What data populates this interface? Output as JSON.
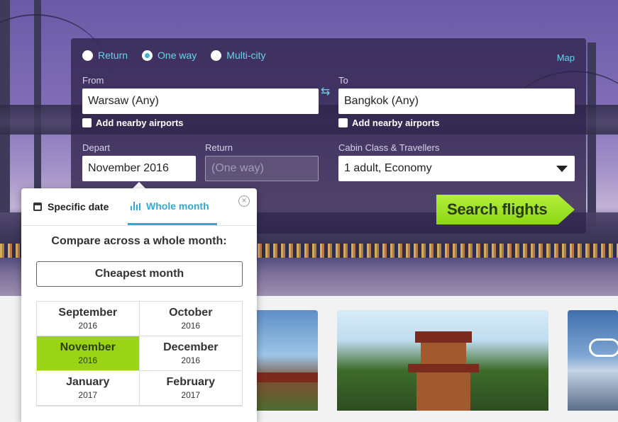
{
  "search": {
    "trip_types": [
      {
        "label": "Return",
        "selected": false
      },
      {
        "label": "One way",
        "selected": true
      },
      {
        "label": "Multi-city",
        "selected": false
      }
    ],
    "map_label": "Map",
    "from_label": "From",
    "from_value": "Warsaw (Any)",
    "to_label": "To",
    "to_value": "Bangkok (Any)",
    "nearby_from_label": "Add nearby airports",
    "nearby_to_label": "Add nearby airports",
    "depart_label": "Depart",
    "depart_value": "November 2016",
    "return_label": "Return",
    "return_value": "(One way)",
    "cabin_label": "Cabin Class & Travellers",
    "cabin_value": "1 adult, Economy",
    "search_button": "Search flights"
  },
  "date_picker": {
    "tab_specific": "Specific date",
    "tab_month": "Whole month",
    "active_tab": "Whole month",
    "compare_title": "Compare across a whole month:",
    "cheapest_button": "Cheapest month",
    "months": [
      {
        "name": "September",
        "year": "2016"
      },
      {
        "name": "October",
        "year": "2016"
      },
      {
        "name": "November",
        "year": "2016",
        "selected": true
      },
      {
        "name": "December",
        "year": "2016"
      },
      {
        "name": "January",
        "year": "2017"
      },
      {
        "name": "February",
        "year": "2017"
      }
    ]
  },
  "colors": {
    "accent": "#33a9d2",
    "link": "#67d3ea",
    "cta": "#9bd414",
    "panel": "#30244c"
  }
}
